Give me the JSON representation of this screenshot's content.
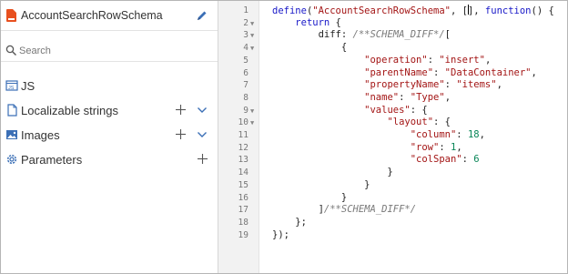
{
  "header": {
    "title": "AccountSearchRowSchema",
    "file_icon": "schema-file-icon",
    "edit_icon": "pencil-icon"
  },
  "search": {
    "placeholder": "Search",
    "icon": "search-icon"
  },
  "sidebar": {
    "items": [
      {
        "label": "JS",
        "icon": "js-icon"
      },
      {
        "label": "Localizable strings",
        "icon": "document-icon",
        "actions": [
          "plus-icon",
          "chevron-down-icon"
        ]
      },
      {
        "label": "Images",
        "icon": "image-icon",
        "actions": [
          "plus-icon",
          "chevron-down-icon"
        ]
      },
      {
        "label": "Parameters",
        "icon": "gear-icon",
        "actions": [
          "plus-icon"
        ]
      }
    ]
  },
  "editor": {
    "line_numbers": [
      "1",
      "2",
      "3",
      "4",
      "5",
      "6",
      "7",
      "8",
      "9",
      "10",
      "11",
      "12",
      "13",
      "14",
      "15",
      "16",
      "17",
      "18",
      "19"
    ],
    "lines": [
      "define(\"AccountSearchRowSchema\", [], function() {",
      "    return {",
      "        diff: /**SCHEMA_DIFF*/[",
      "            {",
      "                \"operation\": \"insert\",",
      "                \"parentName\": \"DataContainer\",",
      "                \"propertyName\": \"items\",",
      "                \"name\": \"Type\",",
      "                \"values\": {",
      "                    \"layout\": {",
      "                        \"column\": 18,",
      "                        \"row\": 1,",
      "                        \"colSpan\": 6",
      "                    }",
      "                }",
      "            }",
      "        ]/**SCHEMA_DIFF*/",
      "    };",
      "});"
    ],
    "foldable_lines": [
      2,
      3,
      4,
      9,
      10
    ]
  },
  "colors": {
    "keyword": "#1818c8",
    "string": "#a31515",
    "number": "#098658",
    "comment": "#7a7a7a",
    "accent": "#2b6cb0",
    "file_icon": "#e8501f"
  }
}
